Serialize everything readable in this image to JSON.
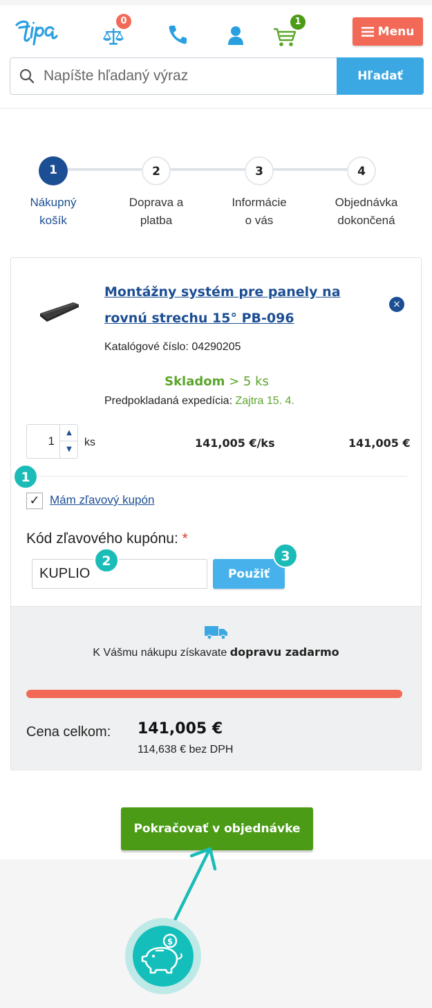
{
  "header": {
    "compare_count": "0",
    "cart_count": "1",
    "menu_label": "Menu",
    "search_placeholder": "Napíšte hľadaný výraz",
    "search_button": "Hľadať"
  },
  "steps": [
    {
      "number": "1",
      "label_line1": "Nákupný",
      "label_line2": "košík"
    },
    {
      "number": "2",
      "label_line1": "Doprava a",
      "label_line2": "platba"
    },
    {
      "number": "3",
      "label_line1": "Informácie",
      "label_line2": "o vás"
    },
    {
      "number": "4",
      "label_line1": "Objednávka",
      "label_line2": "dokončená"
    }
  ],
  "cart": {
    "product_name_line1": "Montážny systém pre panely na",
    "product_name_line2": "rovnú strechu 15° PB-096",
    "remove_icon": "×",
    "catalog_label": "Katalógové číslo:",
    "catalog_number": "04290205",
    "stock_label": "Skladom",
    "stock_qty": "> 5 ks",
    "expedition_label": "Predpokladaná expedícia:",
    "expedition_value": "Zajtra 15. 4.",
    "quantity": "1",
    "unit": "ks",
    "unit_price": "141,005 €/ks",
    "line_total": "141,005 €",
    "coupon_checkbox_label": "Mám zľavový kupón",
    "coupon_field_label": "Kód zľavového kupónu:",
    "coupon_required_mark": "*",
    "coupon_value": "KUPLIO",
    "apply_button": "Použiť"
  },
  "shipping": {
    "text_prefix": "K Vášmu nákupu získavate",
    "text_bold": "dopravu zadarmo",
    "progress_fraction": 1.0,
    "total_label": "Cena celkom:",
    "total_value": "141,005 €",
    "total_without_vat": "114,638 € bez DPH"
  },
  "continue_button": "Pokračovať v objednávke",
  "annotations": [
    "1",
    "2",
    "3"
  ],
  "colors": {
    "primary_blue": "#1c4e94",
    "light_blue": "#3ba8e3",
    "menu_red": "#f26a57",
    "green": "#4c9b17",
    "stock_green": "#5ba52a",
    "teal_annotation": "#1bbcb8"
  }
}
